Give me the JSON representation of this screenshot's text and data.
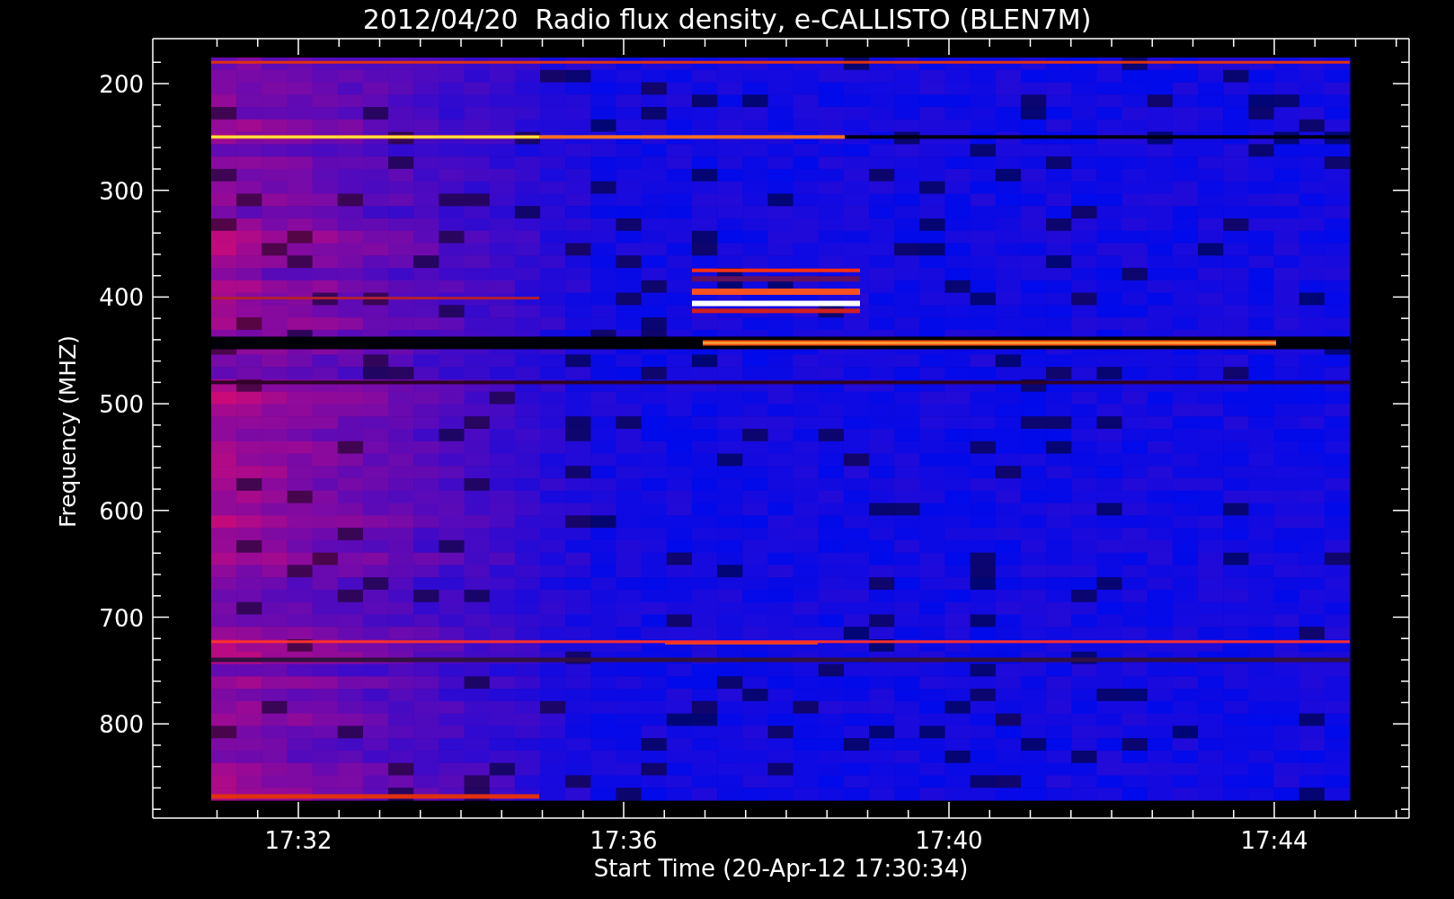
{
  "title": "2012/04/20  Radio flux density, e-CALLISTO (BLEN7M)",
  "y_axis": {
    "label": "Frequency (MHZ)",
    "ticks": [
      "200",
      "300",
      "400",
      "500",
      "600",
      "700",
      "800"
    ]
  },
  "x_axis": {
    "label": "Start Time (20-Apr-12 17:30:34)",
    "ticks": [
      "17:32",
      "17:36",
      "17:40",
      "17:44"
    ]
  }
}
